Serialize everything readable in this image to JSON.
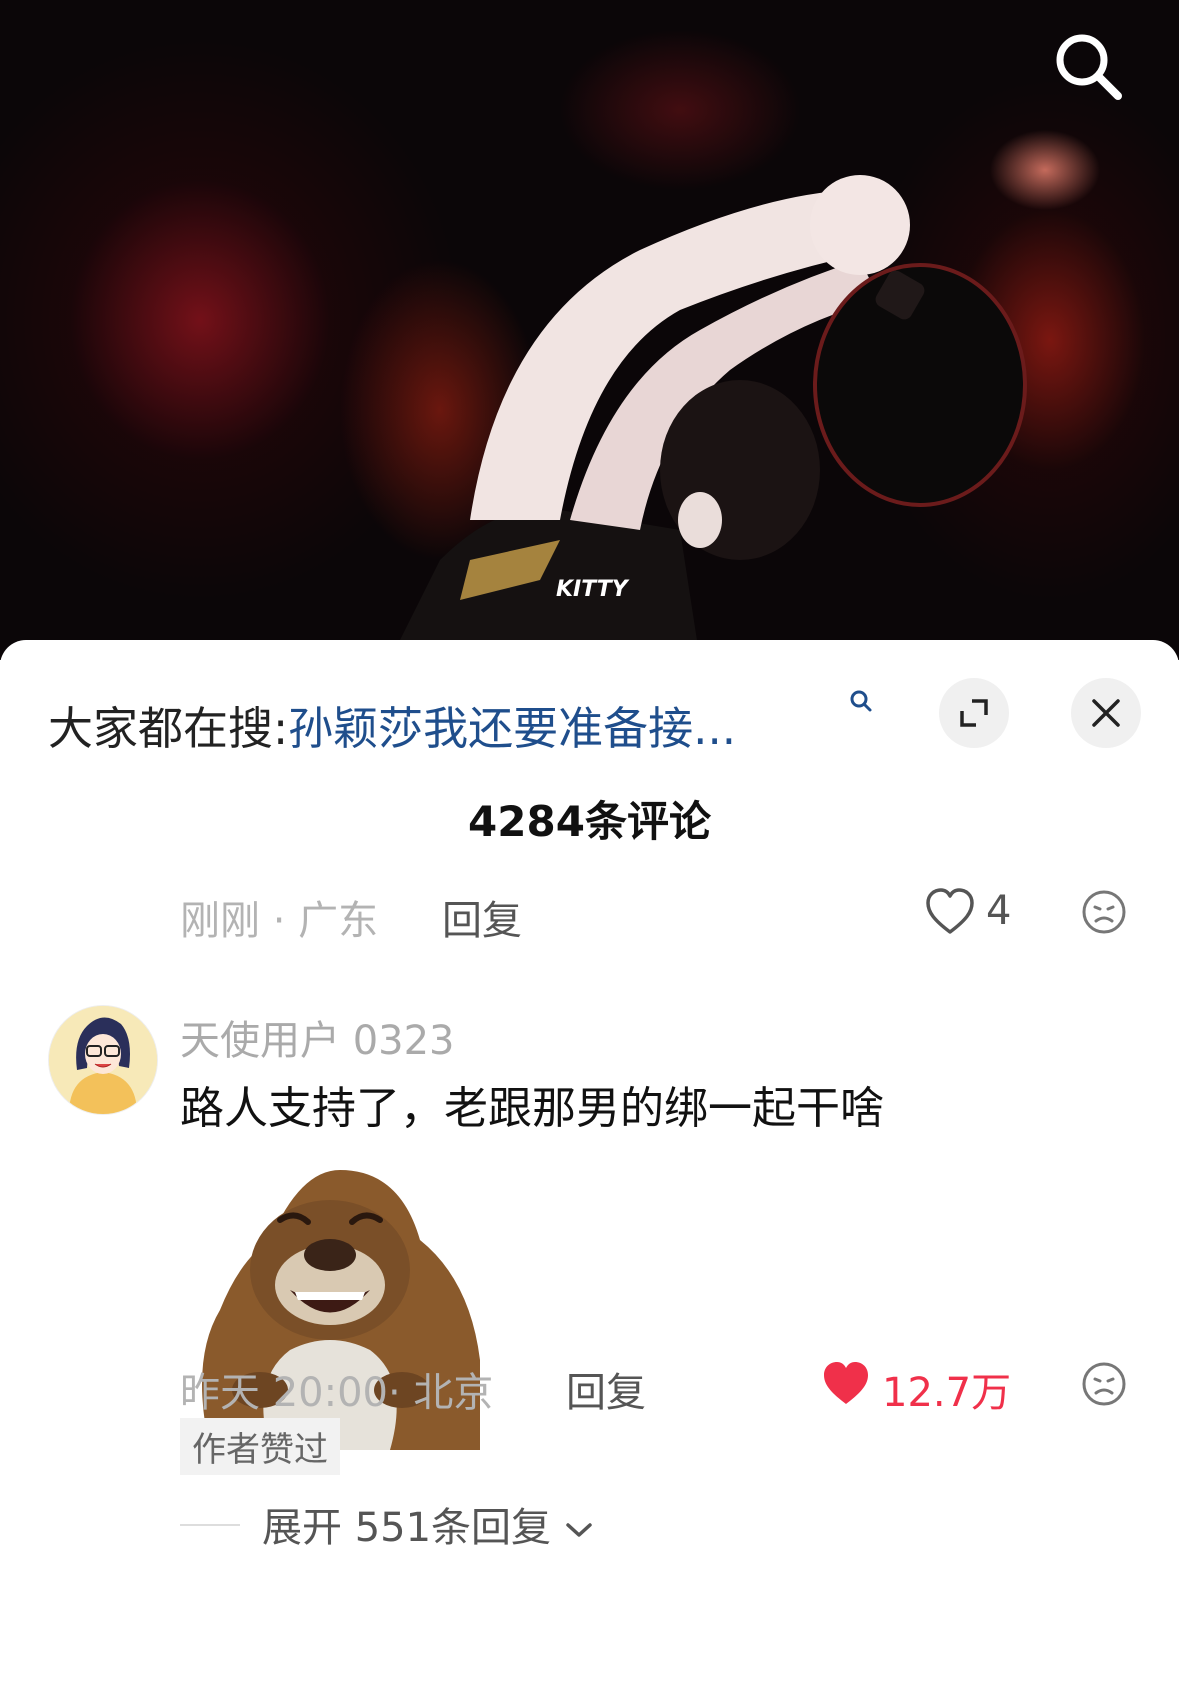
{
  "video": {
    "overlay_text": "KITTY",
    "search_icon": "search-icon"
  },
  "hot_search": {
    "prefix": "大家都在搜:",
    "query": "孙颖莎我还要准备接...",
    "icon": "search-small-icon"
  },
  "controls": {
    "expand_icon": "expand-icon",
    "close_icon": "close-icon"
  },
  "comments_count": "4284条评论",
  "prev_comment": {
    "meta": "刚刚 · 广东",
    "reply": "回复",
    "likes": "4",
    "liked": false
  },
  "comment": {
    "username": "天使用户 0323",
    "text": "路人支持了，老跟那男的绑一起干啥",
    "meta": "昨天 20:00· 北京",
    "reply": "回复",
    "likes": "12.7万",
    "liked": true,
    "badge": "作者赞过",
    "expand": "展开 551条回复"
  },
  "colors": {
    "link": "#1f4e8c",
    "liked": "#f0304a"
  }
}
